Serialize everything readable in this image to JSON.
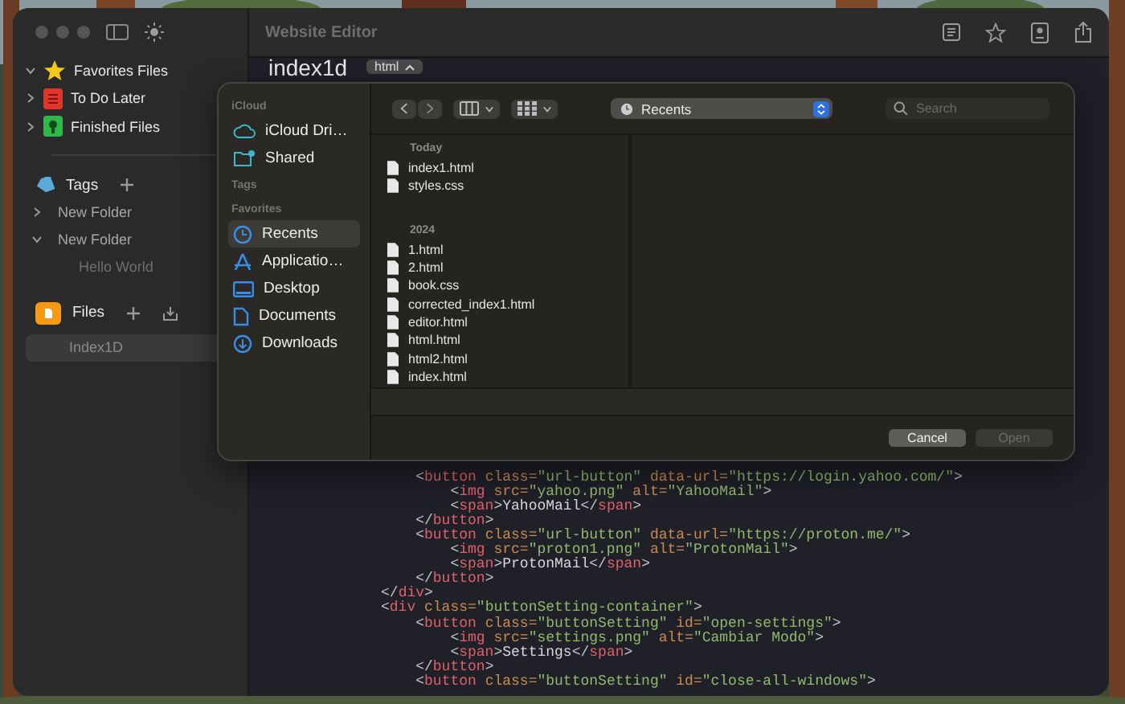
{
  "window": {
    "title": "Website Editor"
  },
  "sidebar": {
    "groups": [
      {
        "label": "Favorites Files",
        "kind": "star",
        "color": "#f5c518",
        "expanded": true
      },
      {
        "label": "To Do Later",
        "kind": "list",
        "color": "#e0352b",
        "expanded": false
      },
      {
        "label": "Finished Files",
        "kind": "badge",
        "color": "#2fb84a",
        "expanded": false
      }
    ],
    "tags": {
      "label": "Tags",
      "folders": [
        {
          "label": "New Folder",
          "expanded": false
        },
        {
          "label": "New Folder",
          "expanded": true,
          "children": [
            {
              "label": "Hello World"
            }
          ]
        }
      ]
    },
    "files": {
      "label": "Files",
      "items": [
        {
          "label": "Index1D",
          "selected": true
        }
      ]
    }
  },
  "editor": {
    "title": "index1d",
    "language": "html",
    "lines": [
      [
        {
          "kind": "p",
          "text": "    <"
        },
        {
          "kind": "tag",
          "text": "button"
        },
        {
          "kind": "attr",
          "text": " class="
        },
        {
          "kind": "str",
          "text": "\"url-button\""
        },
        {
          "kind": "attr",
          "text": " data-url="
        },
        {
          "kind": "str",
          "text": "\"https://login.yahoo.com/\""
        },
        {
          "kind": "p",
          "text": ">"
        }
      ],
      [
        {
          "kind": "p",
          "text": "        <"
        },
        {
          "kind": "tag",
          "text": "img"
        },
        {
          "kind": "attr",
          "text": " src="
        },
        {
          "kind": "str",
          "text": "\"yahoo.png\""
        },
        {
          "kind": "attr",
          "text": " alt="
        },
        {
          "kind": "str",
          "text": "\"YahooMail\""
        },
        {
          "kind": "p",
          "text": ">"
        }
      ],
      [
        {
          "kind": "p",
          "text": "        <"
        },
        {
          "kind": "tag",
          "text": "span"
        },
        {
          "kind": "p",
          "text": ">"
        },
        {
          "kind": "text",
          "text": "YahooMail"
        },
        {
          "kind": "p",
          "text": "</"
        },
        {
          "kind": "tag",
          "text": "span"
        },
        {
          "kind": "p",
          "text": ">"
        }
      ],
      [
        {
          "kind": "p",
          "text": "    </"
        },
        {
          "kind": "tag",
          "text": "button"
        },
        {
          "kind": "p",
          "text": ">"
        }
      ],
      [
        {
          "kind": "p",
          "text": "    <"
        },
        {
          "kind": "tag",
          "text": "button"
        },
        {
          "kind": "attr",
          "text": " class="
        },
        {
          "kind": "str",
          "text": "\"url-button\""
        },
        {
          "kind": "attr",
          "text": " data-url="
        },
        {
          "kind": "str",
          "text": "\"https://proton.me/\""
        },
        {
          "kind": "p",
          "text": ">"
        }
      ],
      [
        {
          "kind": "p",
          "text": "        <"
        },
        {
          "kind": "tag",
          "text": "img"
        },
        {
          "kind": "attr",
          "text": " src="
        },
        {
          "kind": "str",
          "text": "\"proton1.png\""
        },
        {
          "kind": "attr",
          "text": " alt="
        },
        {
          "kind": "str",
          "text": "\"ProtonMail\""
        },
        {
          "kind": "p",
          "text": ">"
        }
      ],
      [
        {
          "kind": "p",
          "text": "        <"
        },
        {
          "kind": "tag",
          "text": "span"
        },
        {
          "kind": "p",
          "text": ">"
        },
        {
          "kind": "text",
          "text": "ProtonMail"
        },
        {
          "kind": "p",
          "text": "</"
        },
        {
          "kind": "tag",
          "text": "span"
        },
        {
          "kind": "p",
          "text": ">"
        }
      ],
      [
        {
          "kind": "p",
          "text": "    </"
        },
        {
          "kind": "tag",
          "text": "button"
        },
        {
          "kind": "p",
          "text": ">"
        }
      ],
      [
        {
          "kind": "p",
          "text": "</"
        },
        {
          "kind": "tag",
          "text": "div"
        },
        {
          "kind": "p",
          "text": ">"
        }
      ],
      [
        {
          "kind": "p",
          "text": "<"
        },
        {
          "kind": "tag",
          "text": "div"
        },
        {
          "kind": "attr",
          "text": " class="
        },
        {
          "kind": "str",
          "text": "\"buttonSetting-container\""
        },
        {
          "kind": "p",
          "text": ">"
        }
      ],
      [
        {
          "kind": "p",
          "text": "    <"
        },
        {
          "kind": "tag",
          "text": "button"
        },
        {
          "kind": "attr",
          "text": " class="
        },
        {
          "kind": "str",
          "text": "\"buttonSetting\""
        },
        {
          "kind": "attr",
          "text": " id="
        },
        {
          "kind": "str",
          "text": "\"open-settings\""
        },
        {
          "kind": "p",
          "text": ">"
        }
      ],
      [
        {
          "kind": "p",
          "text": "        <"
        },
        {
          "kind": "tag",
          "text": "img"
        },
        {
          "kind": "attr",
          "text": " src="
        },
        {
          "kind": "str",
          "text": "\"settings.png\""
        },
        {
          "kind": "attr",
          "text": " alt="
        },
        {
          "kind": "str",
          "text": "\"Cambiar Modo\""
        },
        {
          "kind": "p",
          "text": ">"
        }
      ],
      [
        {
          "kind": "p",
          "text": "        <"
        },
        {
          "kind": "tag",
          "text": "span"
        },
        {
          "kind": "p",
          "text": ">"
        },
        {
          "kind": "text",
          "text": "Settings"
        },
        {
          "kind": "p",
          "text": "</"
        },
        {
          "kind": "tag",
          "text": "span"
        },
        {
          "kind": "p",
          "text": ">"
        }
      ],
      [
        {
          "kind": "p",
          "text": "    </"
        },
        {
          "kind": "tag",
          "text": "button"
        },
        {
          "kind": "p",
          "text": ">"
        }
      ],
      [
        {
          "kind": "p",
          "text": "    <"
        },
        {
          "kind": "tag",
          "text": "button"
        },
        {
          "kind": "attr",
          "text": " class="
        },
        {
          "kind": "str",
          "text": "\"buttonSetting\""
        },
        {
          "kind": "attr",
          "text": " id="
        },
        {
          "kind": "str",
          "text": "\"close-all-windows\""
        },
        {
          "kind": "p",
          "text": ">"
        }
      ]
    ]
  },
  "dialog": {
    "sidebar": [
      {
        "header": "iCloud",
        "items": [
          {
            "label": "iCloud Dri…",
            "kind": "cloud",
            "selected": false
          },
          {
            "label": "Shared",
            "kind": "shared",
            "selected": false
          }
        ]
      },
      {
        "header": "Tags"
      },
      {
        "header": "Favorites",
        "items": [
          {
            "label": "Recents",
            "kind": "clock",
            "selected": true
          },
          {
            "label": "Applicatio…",
            "kind": "apps",
            "selected": false
          },
          {
            "label": "Desktop",
            "kind": "desktop",
            "selected": false
          },
          {
            "label": "Documents",
            "kind": "document",
            "selected": false
          },
          {
            "label": "Downloads",
            "kind": "download",
            "selected": false
          }
        ]
      }
    ],
    "location": "Recents",
    "search": {
      "placeholder": "Search"
    },
    "sections": [
      {
        "header": "Today",
        "files": [
          "index1.html",
          "styles.css"
        ]
      },
      {
        "header": "2024",
        "files": [
          "1.html",
          "2.html",
          "book.css",
          "corrected_index1.html",
          "editor.html",
          "html.html",
          "html2.html",
          "index.html"
        ]
      }
    ],
    "buttons": [
      {
        "label": "Cancel",
        "disabled": false
      },
      {
        "label": "Open",
        "disabled": true
      }
    ]
  }
}
